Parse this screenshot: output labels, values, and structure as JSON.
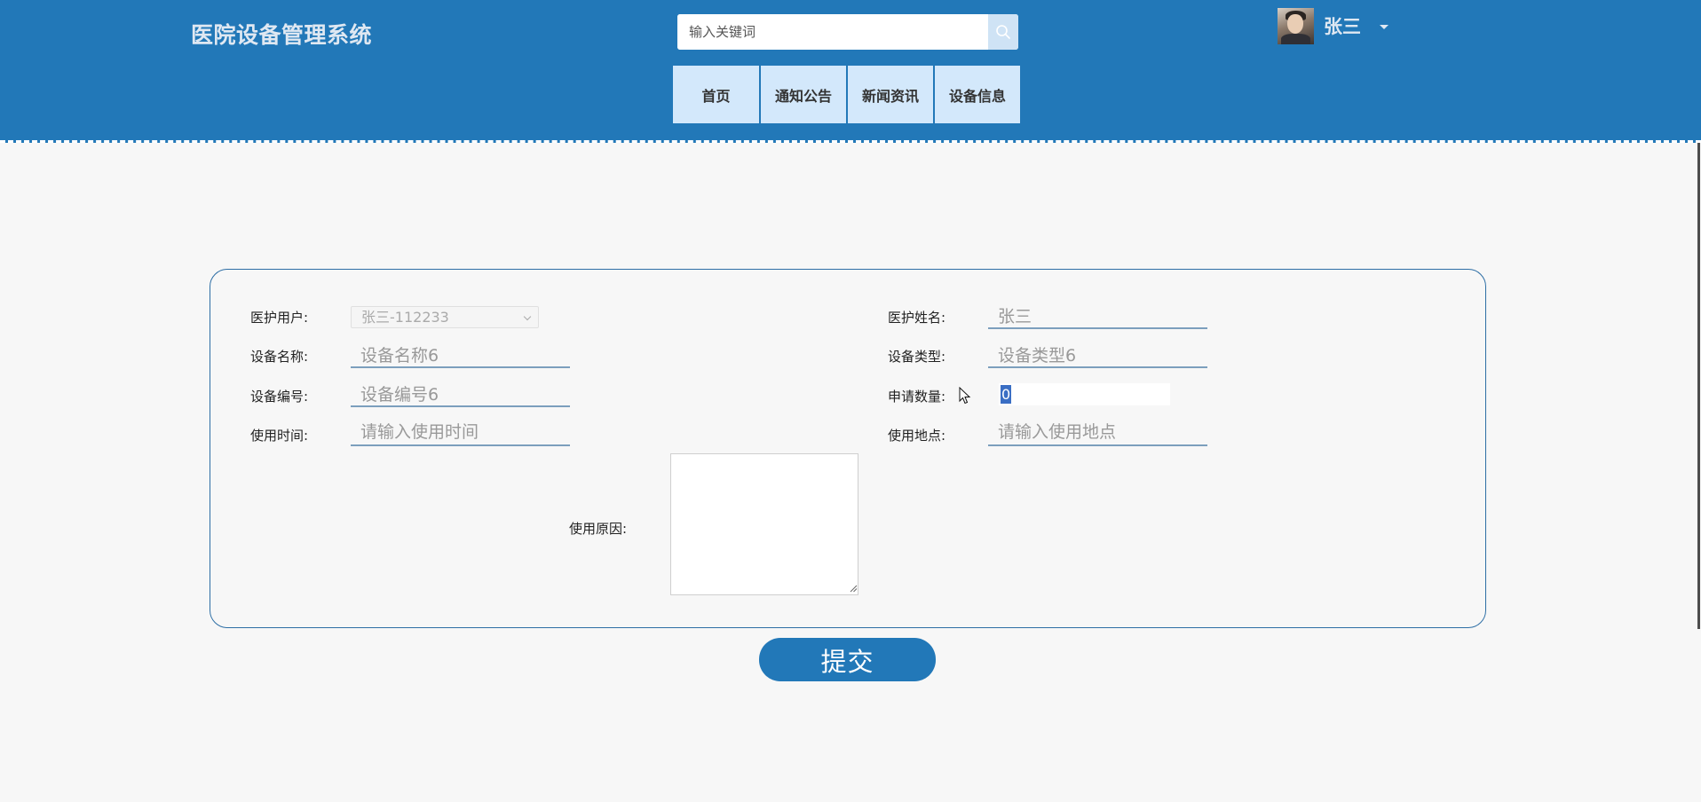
{
  "app_title": "医院设备管理系统",
  "search": {
    "placeholder": "输入关键词",
    "icon": "search-icon"
  },
  "user": {
    "name": "张三",
    "avatar": "avatar",
    "menu_icon": "caret-down-icon"
  },
  "nav": [
    {
      "label": "首页"
    },
    {
      "label": "通知公告"
    },
    {
      "label": "新闻资讯"
    },
    {
      "label": "设备信息"
    }
  ],
  "form": {
    "medical_user": {
      "label": "医护用户:",
      "value": "张三-112233"
    },
    "medical_name": {
      "label": "医护姓名:",
      "value": "张三"
    },
    "device_name": {
      "label": "设备名称:",
      "value": "设备名称6"
    },
    "device_type": {
      "label": "设备类型:",
      "value": "设备类型6"
    },
    "device_no": {
      "label": "设备编号:",
      "value": "设备编号6"
    },
    "apply_qty": {
      "label": "申请数量:",
      "value": "0"
    },
    "use_time": {
      "label": "使用时间:",
      "placeholder": "请输入使用时间"
    },
    "use_place": {
      "label": "使用地点:",
      "placeholder": "请输入使用地点"
    },
    "use_reason": {
      "label": "使用原因:",
      "value": ""
    }
  },
  "submit_label": "提交",
  "colors": {
    "header_bg": "#2278b8",
    "nav_bg": "#d3e8fb",
    "panel_border": "#2d6ea5",
    "accent": "#2278b8"
  }
}
